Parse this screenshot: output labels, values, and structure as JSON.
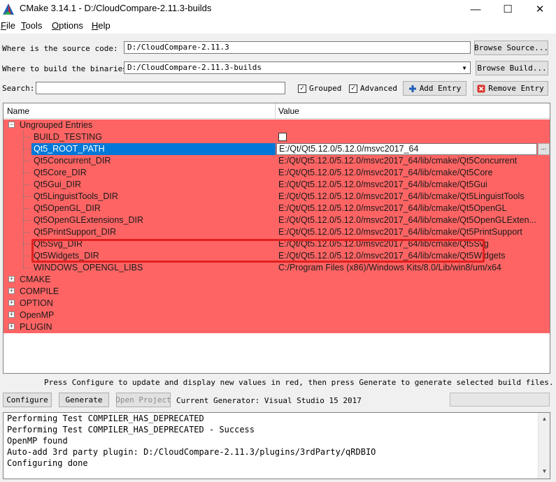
{
  "window": {
    "title": "CMake 3.14.1 - D:/CloudCompare-2.11.3-builds",
    "minimize_glyph": "—",
    "maximize_glyph": "☐",
    "close_glyph": "✕"
  },
  "menu": [
    {
      "key": "F",
      "rest": "ile"
    },
    {
      "key": "T",
      "rest": "ools"
    },
    {
      "key": "O",
      "rest": "ptions"
    },
    {
      "key": "H",
      "rest": "elp"
    }
  ],
  "paths": {
    "source_label": "Where is the source code:",
    "source_value": "D:/CloudCompare-2.11.3",
    "source_button": "Browse Source...",
    "build_label": "Where to build the binaries:",
    "build_value": "D:/CloudCompare-2.11.3-builds",
    "build_button": "Browse Build..."
  },
  "search": {
    "label": "Search:",
    "value": "",
    "grouped_label": "Grouped",
    "grouped_checked": true,
    "advanced_label": "Advanced",
    "advanced_checked": true,
    "add_entry": "Add Entry",
    "remove_entry": "Remove Entry"
  },
  "table": {
    "col_name": "Name",
    "col_value": "Value",
    "group_open": {
      "name": "Ungrouped Entries",
      "entries": [
        {
          "name": "BUILD_TESTING",
          "value": "",
          "checkbox": true
        },
        {
          "name": "Qt5_ROOT_PATH",
          "value": "E:/Qt/Qt5.12.0/5.12.0/msvc2017_64",
          "selected": true
        },
        {
          "name": "Qt5Concurrent_DIR",
          "value": "E:/Qt/Qt5.12.0/5.12.0/msvc2017_64/lib/cmake/Qt5Concurrent"
        },
        {
          "name": "Qt5Core_DIR",
          "value": "E:/Qt/Qt5.12.0/5.12.0/msvc2017_64/lib/cmake/Qt5Core"
        },
        {
          "name": "Qt5Gui_DIR",
          "value": "E:/Qt/Qt5.12.0/5.12.0/msvc2017_64/lib/cmake/Qt5Gui"
        },
        {
          "name": "Qt5LinguistTools_DIR",
          "value": "E:/Qt/Qt5.12.0/5.12.0/msvc2017_64/lib/cmake/Qt5LinguistTools"
        },
        {
          "name": "Qt5OpenGL_DIR",
          "value": "E:/Qt/Qt5.12.0/5.12.0/msvc2017_64/lib/cmake/Qt5OpenGL"
        },
        {
          "name": "Qt5OpenGLExtensions_DIR",
          "value": "E:/Qt/Qt5.12.0/5.12.0/msvc2017_64/lib/cmake/Qt5OpenGLExten..."
        },
        {
          "name": "Qt5PrintSupport_DIR",
          "value": "E:/Qt/Qt5.12.0/5.12.0/msvc2017_64/lib/cmake/Qt5PrintSupport"
        },
        {
          "name": "Qt5Svg_DIR",
          "value": "E:/Qt/Qt5.12.0/5.12.0/msvc2017_64/lib/cmake/Qt5Svg"
        },
        {
          "name": "Qt5Widgets_DIR",
          "value": "E:/Qt/Qt5.12.0/5.12.0/msvc2017_64/lib/cmake/Qt5Widgets"
        },
        {
          "name": "WINDOWS_OPENGL_LIBS",
          "value": "C:/Program Files (x86)/Windows Kits/8.0/Lib/win8/um/x64"
        }
      ]
    },
    "groups_closed": [
      "CMAKE",
      "COMPILE",
      "OPTION",
      "OpenMP",
      "PLUGIN"
    ],
    "editor_button": "..."
  },
  "hint": "Press Configure to update and display new values in red, then press Generate to generate selected build files.",
  "actions": {
    "configure": "Configure",
    "generate": "Generate",
    "open_project": "Open Project",
    "generator": "Current Generator: Visual Studio 15 2017"
  },
  "output": [
    "Performing Test COMPILER_HAS_DEPRECATED",
    "Performing Test COMPILER_HAS_DEPRECATED - Success",
    "OpenMP found",
    "Auto-add 3rd party plugin: D:/CloudCompare-2.11.3/plugins/3rdParty/qRDBIO",
    "Configuring done"
  ],
  "colors": {
    "changed_row": "#ff6464",
    "selection": "#0078d7",
    "callout": "#e02020"
  }
}
